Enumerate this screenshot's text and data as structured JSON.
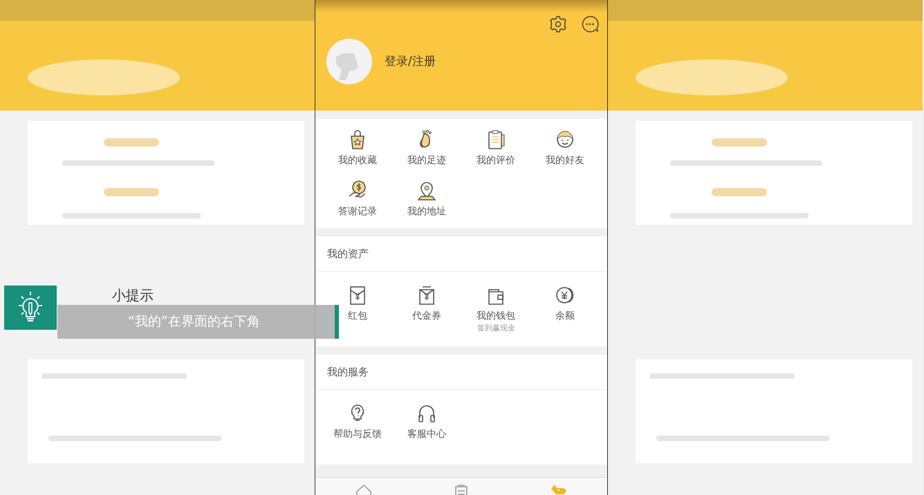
{
  "header": {
    "login_text": "登录/注册"
  },
  "shortcuts": [
    {
      "label": "我的收藏"
    },
    {
      "label": "我的足迹"
    },
    {
      "label": "我的评价"
    },
    {
      "label": "我的好友"
    },
    {
      "label": "答谢记录"
    },
    {
      "label": "我的地址"
    }
  ],
  "sections": [
    {
      "title": "我的资产",
      "items": [
        {
          "label": "红包"
        },
        {
          "label": "代金券"
        },
        {
          "label": "我的钱包",
          "sublabel": "签到赢现金"
        },
        {
          "label": "余额"
        }
      ]
    },
    {
      "title": "我的服务",
      "items": [
        {
          "label": "帮助与反馈"
        },
        {
          "label": "客服中心"
        }
      ]
    }
  ],
  "bottom_nav": [
    {
      "selected": false
    },
    {
      "selected": false
    },
    {
      "selected": true
    }
  ],
  "tip": {
    "title": "小提示",
    "text": "“我的”在界面的右下角"
  }
}
